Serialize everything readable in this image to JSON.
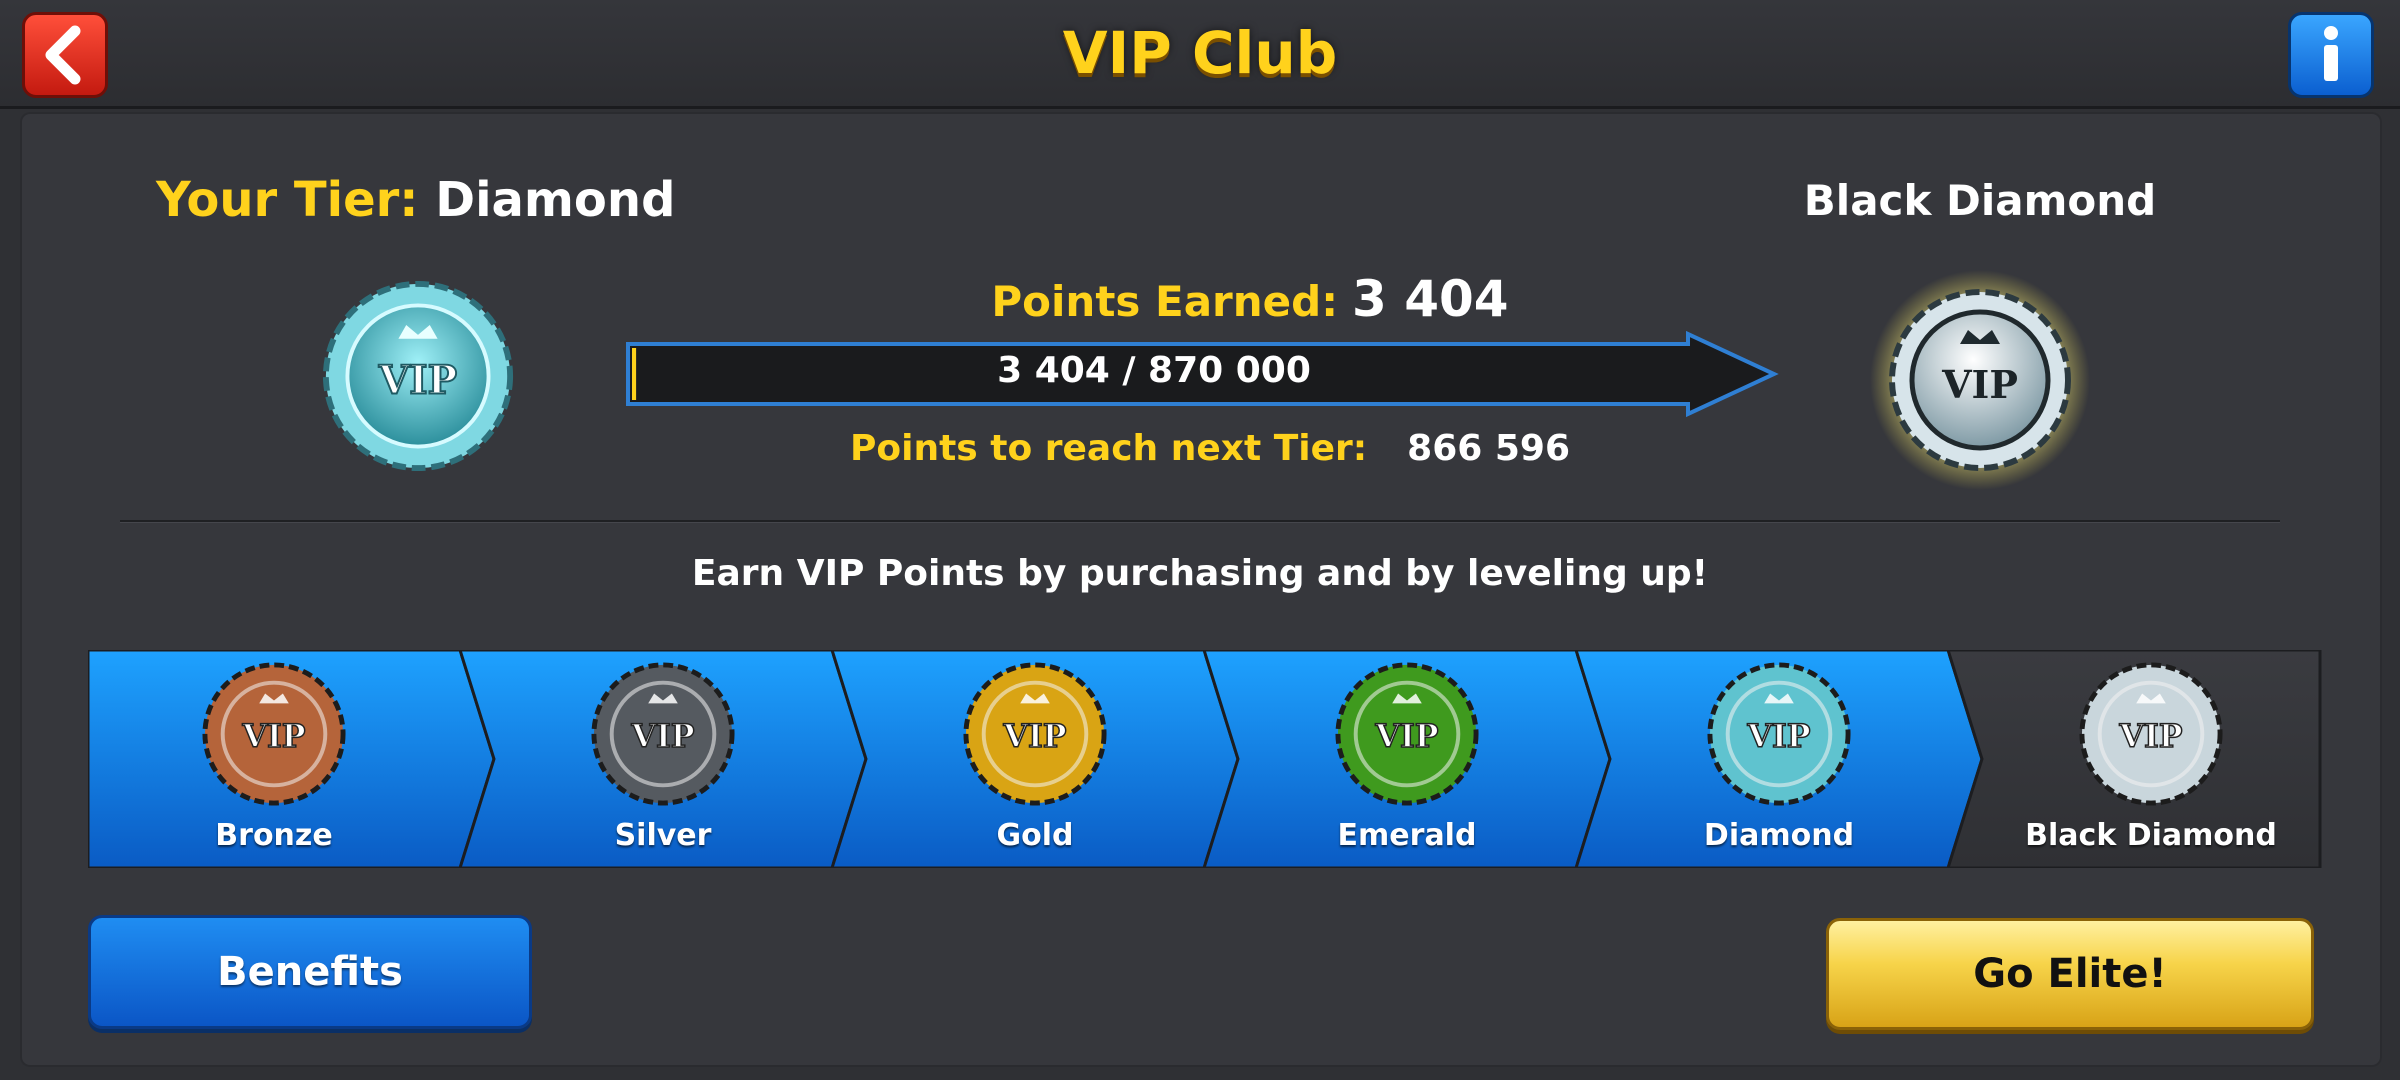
{
  "header": {
    "title": "VIP Club",
    "back_icon": "chevron-left-icon",
    "info_icon": "info-icon",
    "info_glyph": "i"
  },
  "status": {
    "your_tier_label": "Your Tier:",
    "your_tier_value": "Diamond",
    "next_tier": "Black Diamond",
    "points_earned_label": "Points Earned:",
    "points_earned_value": "3 404",
    "progress_text": "3 404 / 870 000",
    "progress_fraction": 0.0039,
    "to_next_label": "Points to reach next Tier:",
    "to_next_value": "866 596"
  },
  "message": "Earn VIP Points by purchasing and by leveling up!",
  "badge_text": "VIP",
  "tiers": [
    {
      "name": "Bronze",
      "color": "#b5643a"
    },
    {
      "name": "Silver",
      "color": "#555a60"
    },
    {
      "name": "Gold",
      "color": "#d9a414"
    },
    {
      "name": "Emerald",
      "color": "#3f9a1e"
    },
    {
      "name": "Diamond",
      "color": "#5fc3cf"
    },
    {
      "name": "Black Diamond",
      "color": "#c9d6dc"
    }
  ],
  "buttons": {
    "benefits": "Benefits",
    "go_elite": "Go Elite!"
  },
  "colors": {
    "accent_yellow": "#ffd21c",
    "tier_blue": "#1484e4",
    "locked_gray": "#3a3b40"
  }
}
